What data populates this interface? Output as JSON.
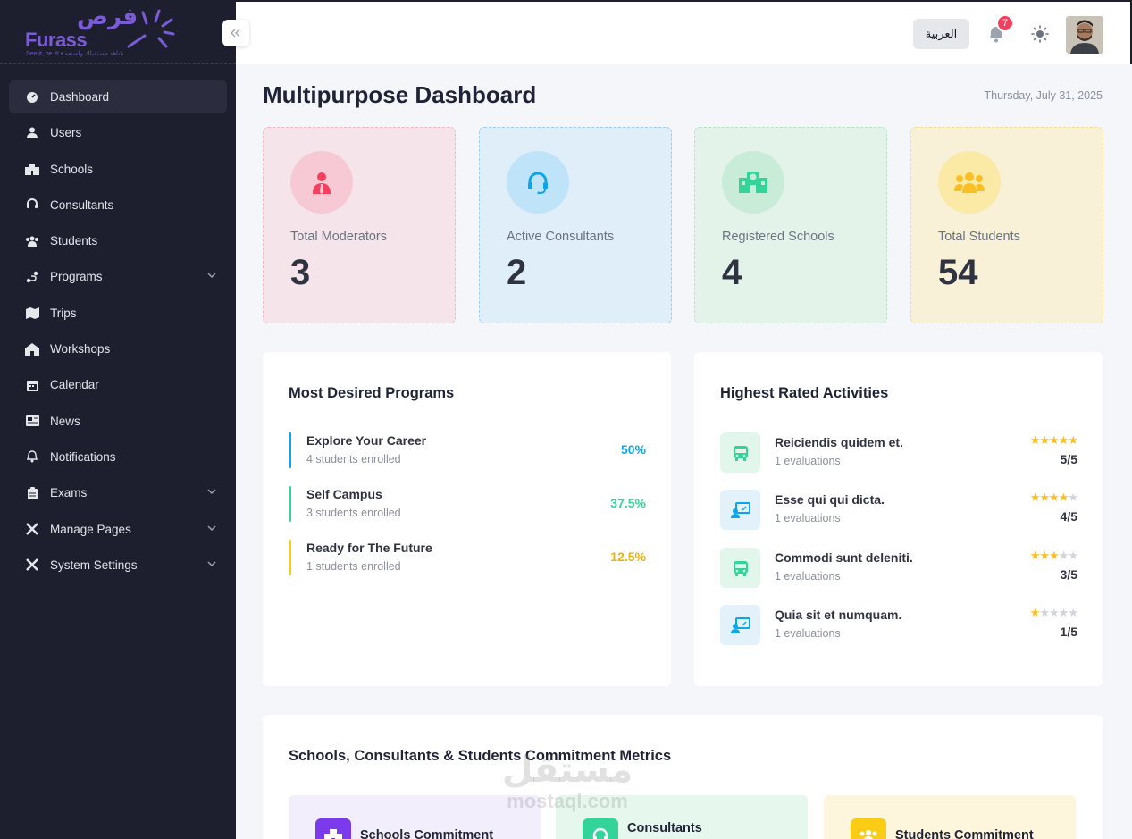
{
  "brand": {
    "name_ar": "فرص",
    "name_en": "Furass",
    "tagline": "See it, be it! • شاهد مستقبلك واصنعه"
  },
  "sidebar": {
    "items": [
      {
        "label": "Dashboard",
        "icon": "dashboard-icon"
      },
      {
        "label": "Users",
        "icon": "user-icon"
      },
      {
        "label": "Schools",
        "icon": "school-icon"
      },
      {
        "label": "Consultants",
        "icon": "headset-icon"
      },
      {
        "label": "Students",
        "icon": "users-group-icon"
      },
      {
        "label": "Programs",
        "icon": "route-icon"
      },
      {
        "label": "Trips",
        "icon": "map-icon"
      },
      {
        "label": "Workshops",
        "icon": "warehouse-icon"
      },
      {
        "label": "Calendar",
        "icon": "calendar-icon"
      },
      {
        "label": "News",
        "icon": "newspaper-icon"
      },
      {
        "label": "Notifications",
        "icon": "bell-icon"
      },
      {
        "label": "Exams",
        "icon": "clipboard-icon"
      },
      {
        "label": "Manage Pages",
        "icon": "tools-icon"
      },
      {
        "label": "System Settings",
        "icon": "tools-icon"
      }
    ]
  },
  "header": {
    "lang_label": "العربية",
    "notification_count": "7"
  },
  "main": {
    "title": "Multipurpose Dashboard",
    "date": "Thursday, July 31, 2025",
    "stats": [
      {
        "label": "Total Moderators",
        "value": "3",
        "color": "#f43f5e"
      },
      {
        "label": "Active Consultants",
        "value": "2",
        "color": "#0ea5e9"
      },
      {
        "label": "Registered Schools",
        "value": "4",
        "color": "#34d399"
      },
      {
        "label": "Total Students",
        "value": "54",
        "color": "#fbbf24"
      }
    ],
    "programs": {
      "title": "Most Desired Programs",
      "items": [
        {
          "name": "Explore Your Career",
          "enrolled": "4 students enrolled",
          "percent": "50%",
          "color": "#0ea5e9"
        },
        {
          "name": "Self Campus",
          "enrolled": "3 students enrolled",
          "percent": "37.5%",
          "color": "#34d399"
        },
        {
          "name": "Ready for The Future",
          "enrolled": "1 students enrolled",
          "percent": "12.5%",
          "color": "#facc15"
        }
      ]
    },
    "activities": {
      "title": "Highest Rated Activities",
      "items": [
        {
          "name": "Reiciendis quidem et.",
          "evaluations": "1 evaluations",
          "rating": "5/5",
          "stars": 5,
          "icon": "bus-icon"
        },
        {
          "name": "Esse qui qui dicta.",
          "evaluations": "1 evaluations",
          "rating": "4/5",
          "stars": 4,
          "icon": "presentation-icon"
        },
        {
          "name": "Commodi sunt deleniti.",
          "evaluations": "1 evaluations",
          "rating": "3/5",
          "stars": 3,
          "icon": "bus-icon"
        },
        {
          "name": "Quia sit et numquam.",
          "evaluations": "1 evaluations",
          "rating": "1/5",
          "stars": 1,
          "icon": "presentation-icon"
        }
      ]
    },
    "metrics": {
      "title": "Schools, Consultants & Students Commitment Metrics",
      "items": [
        {
          "label": "Schools Commitment",
          "color": "#7c3aed"
        },
        {
          "label": "Consultants",
          "color": "#34d399"
        },
        {
          "label": "Students Commitment",
          "color": "#facc15"
        }
      ]
    },
    "watermark": {
      "ar": "مستقل",
      "en": "mostaql.com"
    }
  }
}
